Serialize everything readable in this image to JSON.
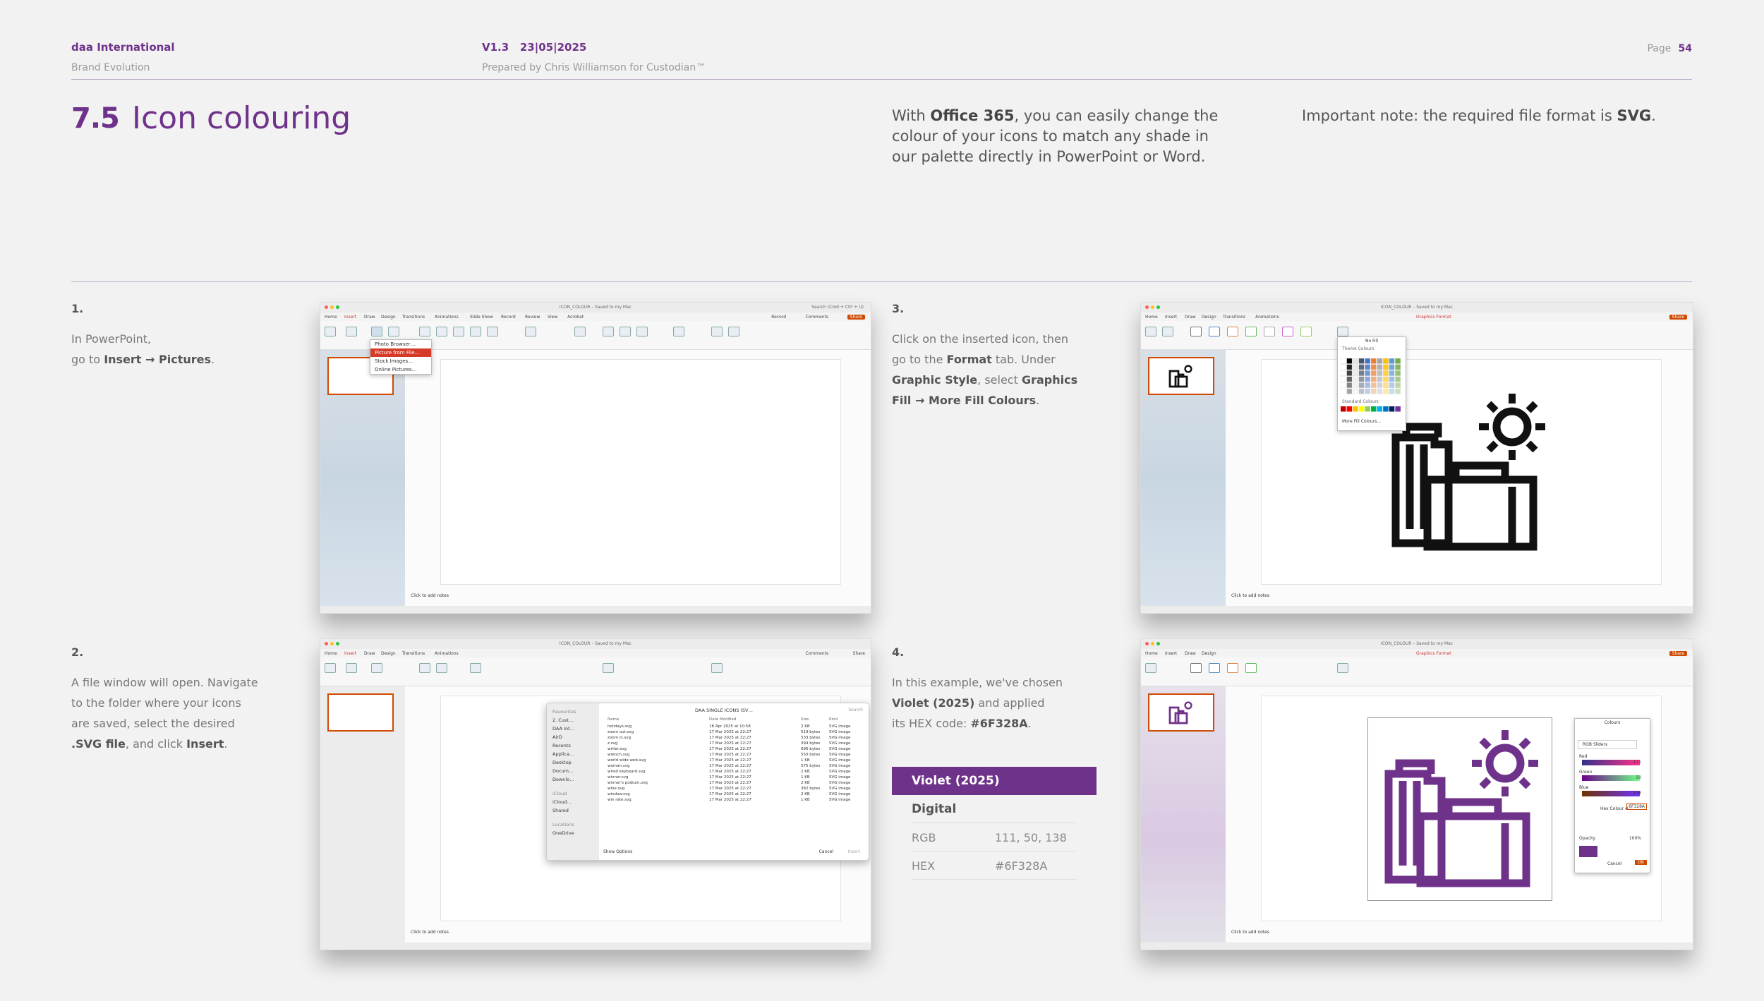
{
  "header": {
    "brand": "daa International",
    "brand_sub": "Brand Evolution",
    "version": "V1.3",
    "date": "23|05|2025",
    "prepared": "Prepared by Chris Williamson for Custodian™",
    "page_label": "Page",
    "page_number": "54"
  },
  "section": {
    "number": "7.5",
    "title": "Icon colouring"
  },
  "intro": {
    "p1_a": "With ",
    "p1_b": "Office 365",
    "p1_c": ", you can easily change the colour of your icons to match any shade in our palette directly in PowerPoint or Word.",
    "p2_a": "Important note: the required file format is ",
    "p2_b": "SVG",
    "p2_c": "."
  },
  "steps": [
    {
      "num": "1.",
      "t1": "In PowerPoint,",
      "t2a": "go to ",
      "t2b": "Insert",
      "t2c": " → ",
      "t2d": "Pictures",
      "t2e": "."
    },
    {
      "num": "2.",
      "t1": "A file window will open. Navigate",
      "t2": "to the folder where your icons",
      "t3": "are saved, select the desired",
      "t4a": ".SVG file",
      "t4b": ", and click ",
      "t4c": "Insert",
      "t4d": "."
    },
    {
      "num": "3.",
      "t1a": "Click on the inserted icon, then",
      "t2a": "go to the ",
      "t2b": "Format",
      "t2c": " tab. Under",
      "t3a": "Graphic Style",
      "t3b": ", select ",
      "t3c": "Graphics",
      "t4a": "Fill",
      "t4b": " → ",
      "t4c": "More Fill Colours",
      "t4d": "."
    },
    {
      "num": "4.",
      "t1": "In this example, we've chosen",
      "t2a": "Violet (2025)",
      "t2b": " and applied",
      "t3a": "its HEX code: ",
      "t3b": "#6F328A",
      "t3c": "."
    }
  ],
  "colour_card": {
    "name": "Violet (2025)",
    "group": "Digital",
    "rgb_label": "RGB",
    "rgb_value": "111, 50, 138",
    "hex_label": "HEX",
    "hex_value": "#6F328A"
  },
  "screens": {
    "menu_items": [
      "Home",
      "Insert",
      "Draw",
      "Design",
      "Transitions",
      "Animations",
      "Slide Show",
      "Record",
      "Review",
      "View",
      "Acrobat"
    ],
    "graphics_format_tab": "Graphics Format",
    "doc_title": "ICON_COLOUR – Saved to my Mac",
    "search_placeholder": "Search (Cmd + Ctrl + U)",
    "record": "Record",
    "comments": "Comments",
    "share": "Share",
    "notes_placeholder": "Click to add notes",
    "pictures_menu": [
      "Photo Browser…",
      "Picture from File…",
      "Stock Images…",
      "Online Pictures…"
    ],
    "file_window": {
      "folder": "DAA SINGLE ICONS (SV…",
      "search": "Search",
      "sidebar": [
        "Favourites",
        "2. Cust…",
        "DAA Int…",
        "AirD",
        "Recents",
        "Applica…",
        "Desktop",
        "Docum…",
        "Downlo…",
        "iCloud",
        "iCloud…",
        "Shared",
        "Locations",
        "OneDrive"
      ],
      "columns": [
        "Name",
        "Date Modified",
        "Size",
        "Kind"
      ],
      "files": [
        [
          "holidays.svg",
          "18 Apr 2025 at 10:58",
          "2 KB",
          "SVG image"
        ],
        [
          "zoom out.svg",
          "17 Mar 2025 at 22:27",
          "519 bytes",
          "SVG image"
        ],
        [
          "zoom in.svg",
          "17 Mar 2025 at 22:27",
          "533 bytes",
          "SVG image"
        ],
        [
          "z.svg",
          "17 Mar 2025 at 22:27",
          "394 bytes",
          "SVG image"
        ],
        [
          "writer.svg",
          "17 Mar 2025 at 22:27",
          "696 bytes",
          "SVG image"
        ],
        [
          "wrench.svg",
          "17 Mar 2025 at 22:27",
          "550 bytes",
          "SVG image"
        ],
        [
          "world wide web.svg",
          "17 Mar 2025 at 22:27",
          "1 KB",
          "SVG image"
        ],
        [
          "woman.svg",
          "17 Mar 2025 at 22:27",
          "575 bytes",
          "SVG image"
        ],
        [
          "wired keyboard.svg",
          "17 Mar 2025 at 22:27",
          "2 KB",
          "SVG image"
        ],
        [
          "winner.svg",
          "17 Mar 2025 at 22:27",
          "1 KB",
          "SVG image"
        ],
        [
          "winner's podium.svg",
          "17 Mar 2025 at 22:27",
          "2 KB",
          "SVG image"
        ],
        [
          "wine.svg",
          "17 Mar 2025 at 22:27",
          "382 bytes",
          "SVG image"
        ],
        [
          "window.svg",
          "17 Mar 2025 at 22:27",
          "2 KB",
          "SVG image"
        ],
        [
          "win rate.svg",
          "17 Mar 2025 at 22:27",
          "1 KB",
          "SVG image"
        ]
      ],
      "show_options": "Show Options",
      "cancel": "Cancel",
      "insert": "Insert"
    },
    "fill_menu": {
      "no_fill": "No Fill",
      "theme_colours": "Theme Colours",
      "standard_colours": "Standard Colours",
      "more": "More Fill Colours…"
    },
    "colour_dialog": {
      "title": "Colours",
      "mode": "RGB Sliders",
      "red": "Red",
      "red_val": "111",
      "green": "Green",
      "green_val": "50",
      "blue": "Blue",
      "blue_val": "138",
      "hex_label": "Hex Colour #",
      "hex_val": "6F328A",
      "opacity": "Opacity",
      "opacity_val": "100%",
      "cancel": "Cancel",
      "ok": "OK"
    }
  },
  "colors": {
    "violet": "#6F328A",
    "accent_red": "#d04a02"
  }
}
